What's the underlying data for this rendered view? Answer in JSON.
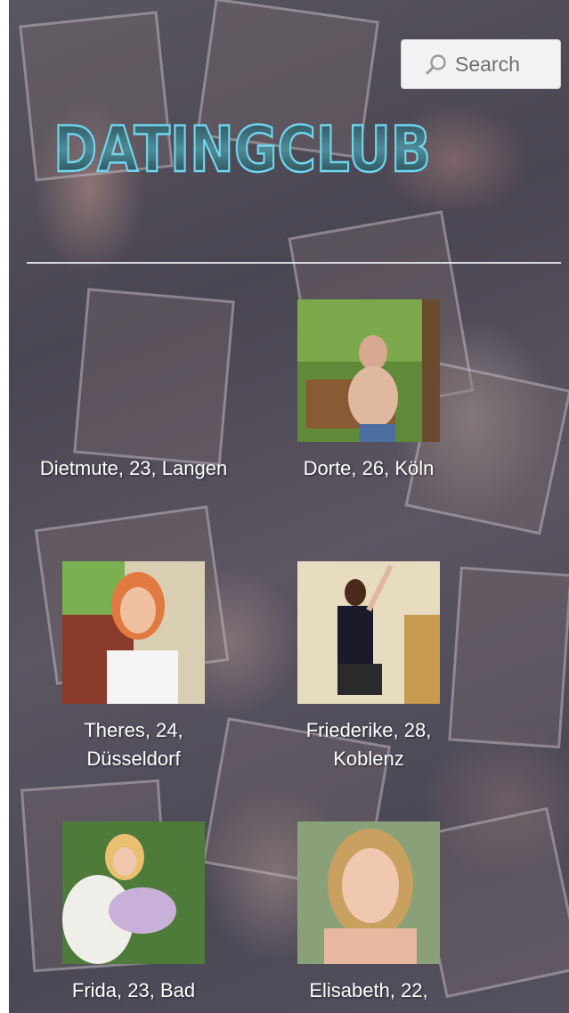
{
  "search": {
    "placeholder": "Search",
    "icon": "magnifier-icon"
  },
  "logo": {
    "text": "DATINGCLUB"
  },
  "profiles": [
    {
      "label": "Dietmute, 23, Langen",
      "has_photo": false
    },
    {
      "label": "Dorte, 26, Köln",
      "has_photo": true
    },
    {
      "label": "Theres, 24, Düsseldorf",
      "has_photo": true
    },
    {
      "label": "Friederike, 28, Koblenz",
      "has_photo": true
    },
    {
      "label": "Frida, 23, Bad",
      "has_photo": true
    },
    {
      "label": "Elisabeth, 22,",
      "has_photo": true
    }
  ],
  "colors": {
    "background_overlay": "#4e4a57",
    "logo_fill": "#3a6f7a",
    "logo_glow": "#5fc8e0",
    "text": "#ffffff"
  }
}
